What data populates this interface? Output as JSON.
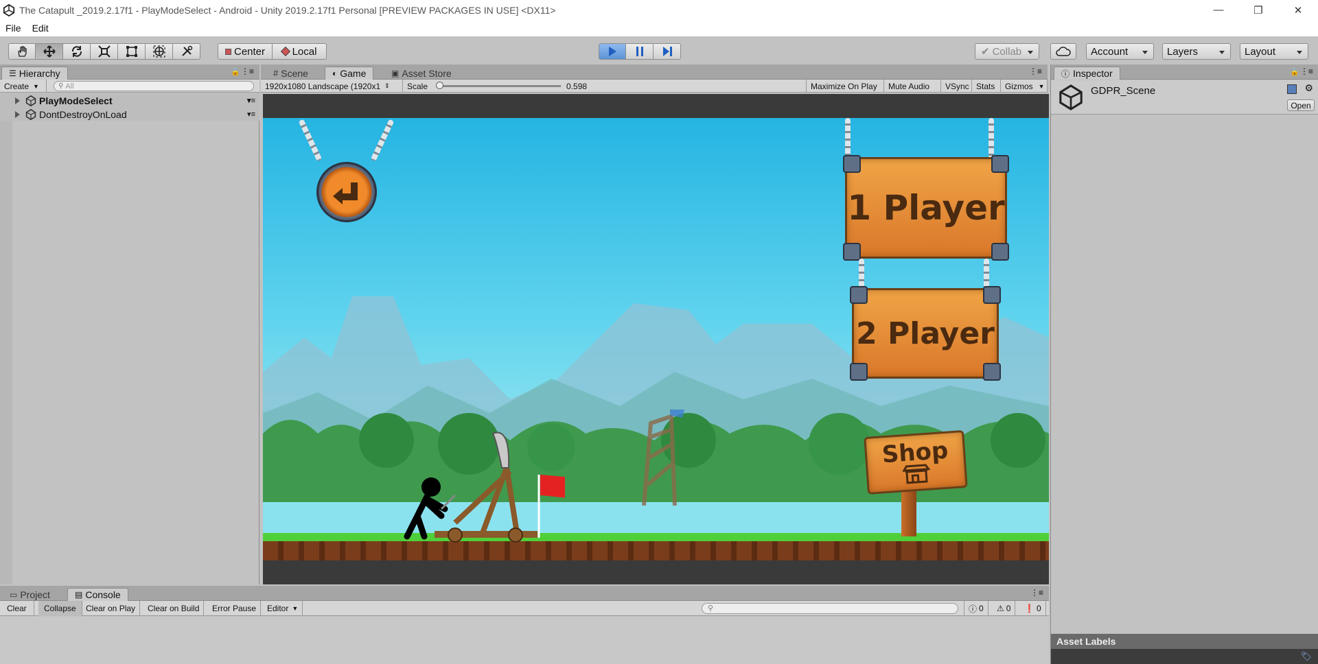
{
  "window": {
    "title": "The Catapult _2019.2.17f1 - PlayModeSelect - Android - Unity 2019.2.17f1 Personal [PREVIEW PACKAGES IN USE] <DX11>",
    "minimize": "—",
    "restore": "❐",
    "close": "✕"
  },
  "menu": {
    "file": "File",
    "edit": "Edit"
  },
  "toolbar": {
    "pivot": "Center",
    "space": "Local",
    "collab": "Collab",
    "account": "Account",
    "layers": "Layers",
    "layout": "Layout"
  },
  "hierarchy": {
    "tab": "Hierarchy",
    "create": "Create",
    "search_placeholder": "All",
    "items": [
      "PlayModeSelect",
      "DontDestroyOnLoad"
    ]
  },
  "center_tabs": {
    "scene": "Scene",
    "game": "Game",
    "asset_store": "Asset Store"
  },
  "game_bar": {
    "resolution": "1920x1080 Landscape (1920x1",
    "scale_label": "Scale",
    "scale_value": "0.598",
    "scale_fraction": 0.0,
    "maximize": "Maximize On Play",
    "mute": "Mute Audio",
    "vsync": "VSync",
    "stats": "Stats",
    "gizmos": "Gizmos"
  },
  "game": {
    "player1": "1 Player",
    "player2": "2 Player",
    "shop": "Shop"
  },
  "inspector": {
    "tab": "Inspector",
    "object": "GDPR_Scene",
    "open": "Open",
    "asset_labels": "Asset Labels"
  },
  "bottom_tabs": {
    "project": "Project",
    "console": "Console"
  },
  "console_bar": {
    "clear": "Clear",
    "collapse": "Collapse",
    "clear_on_play": "Clear on Play",
    "clear_on_build": "Clear on Build",
    "error_pause": "Error Pause",
    "editor": "Editor",
    "info_count": "0",
    "warn_count": "0",
    "error_count": "0"
  },
  "colors": {
    "play_active": "#4a8fe0",
    "game_sky": "#34c6e8",
    "sign_wood": "#e08a35"
  }
}
